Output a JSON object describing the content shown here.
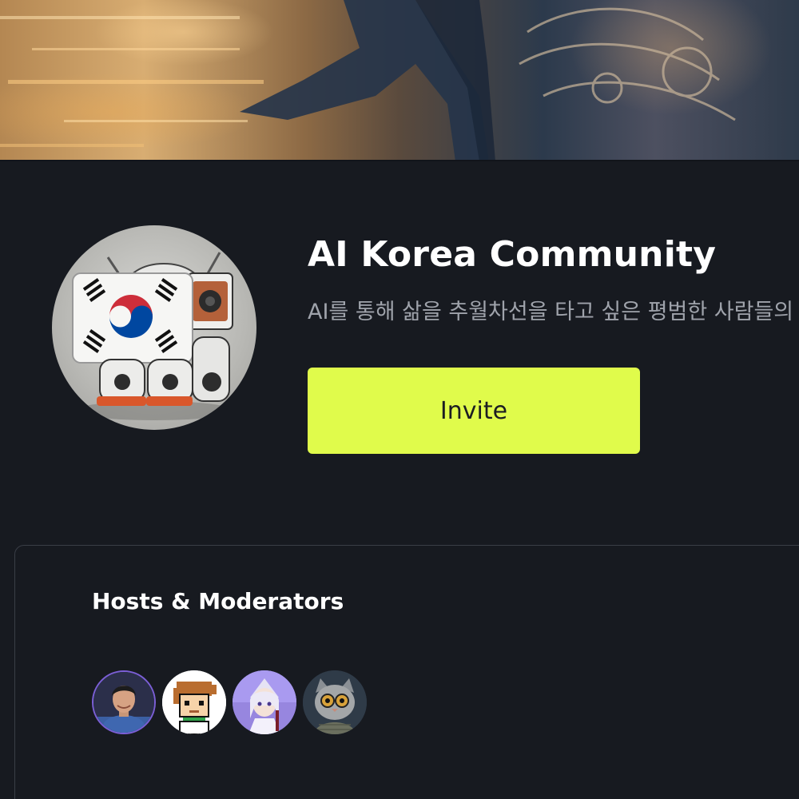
{
  "community": {
    "title": "AI Korea Community",
    "description": "AI를 통해 삶을 추월차선을 타고 싶은 평범한 사람들의 커뮤니티",
    "invite_label": "Invite",
    "accent_color": "#e0fb4b"
  },
  "banner": {
    "icon": "banner-image"
  },
  "hosts": {
    "title": "Hosts & Moderators",
    "avatars": [
      {
        "name": "host-avatar-1",
        "icon": "photo-man"
      },
      {
        "name": "host-avatar-2",
        "icon": "pixel-art-character"
      },
      {
        "name": "host-avatar-3",
        "icon": "anime-character"
      },
      {
        "name": "host-avatar-4",
        "icon": "cat-with-glasses"
      }
    ]
  }
}
